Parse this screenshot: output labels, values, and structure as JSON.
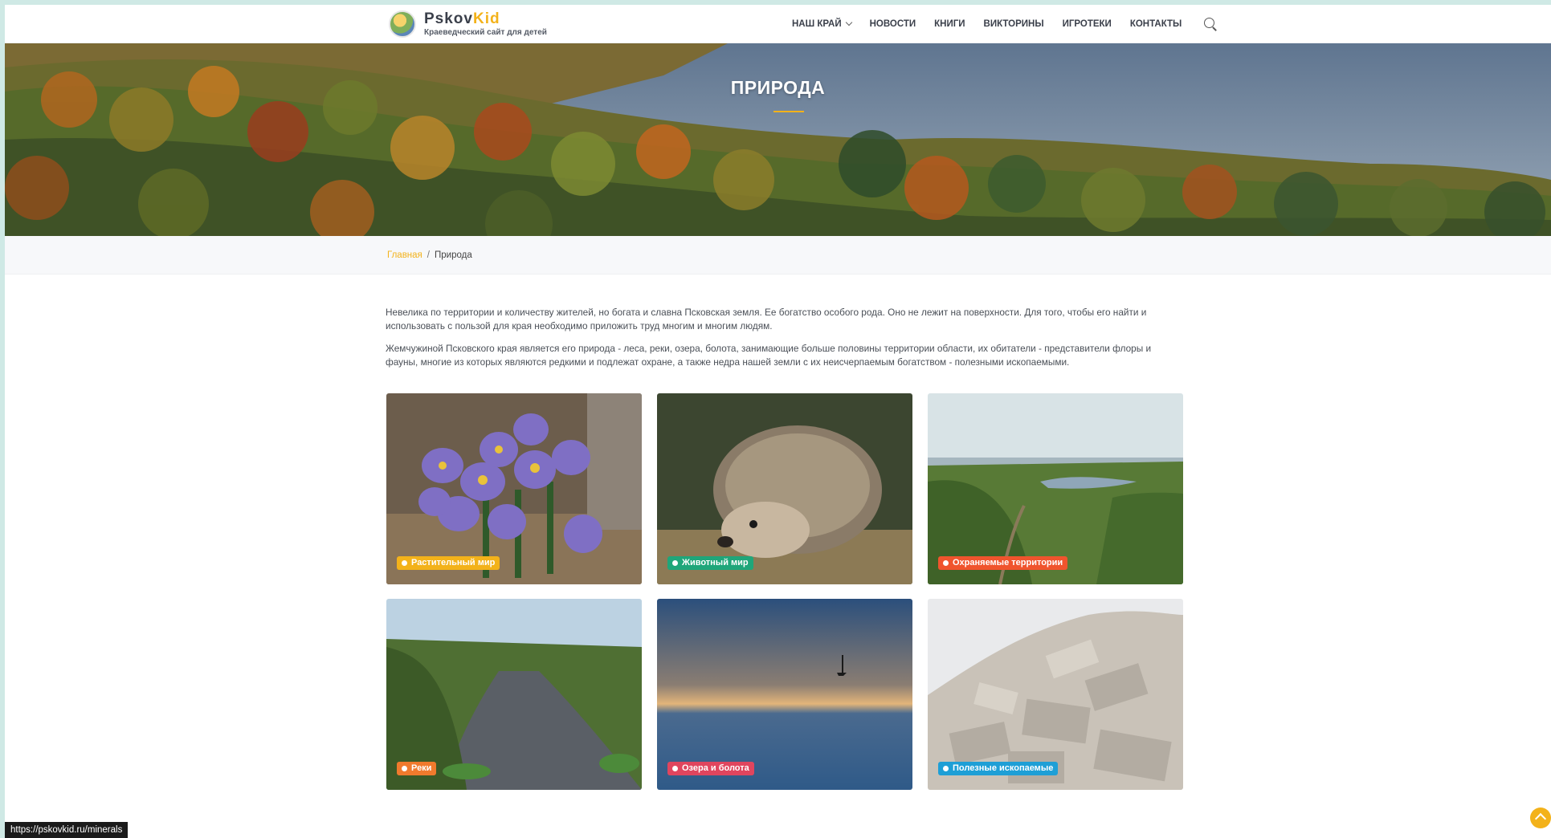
{
  "brand": {
    "name_part1": "Pskov",
    "name_part2": "Kid",
    "tagline": "Краеведческий сайт для детей"
  },
  "nav": {
    "items": [
      {
        "label": "НАШ КРАЙ",
        "has_dropdown": true
      },
      {
        "label": "НОВОСТИ"
      },
      {
        "label": "КНИГИ"
      },
      {
        "label": "ВИКТОРИНЫ"
      },
      {
        "label": "ИГРОТЕКИ"
      },
      {
        "label": "КОНТАКТЫ"
      }
    ],
    "search_icon": "search-icon"
  },
  "hero": {
    "title": "ПРИРОДА"
  },
  "breadcrumb": {
    "home": "Главная",
    "separator": "/",
    "current": "Природа"
  },
  "intro": {
    "p1": "Невелика по территории и количеству жителей, но богата и славна Псковская земля. Ее богатство особого рода. Оно не лежит на поверхности. Для того, чтобы его найти и использовать с пользой для края необходимо приложить труд многим и многим людям.",
    "p2": "Жемчужиной Псковского края является его природа - леса, реки, озера, болота, занимающие больше половины территории области, их обитатели - представители флоры и фауны, многие из которых являются редкими и подлежат охране, а также недра нашей земли с их неисчерпаемым богатством - полезными ископаемыми."
  },
  "cards": [
    {
      "label": "Растительный мир",
      "color": "#f3b21a"
    },
    {
      "label": "Животный мир",
      "color": "#1fa67a"
    },
    {
      "label": "Охраняемые территории",
      "color": "#f0542d"
    },
    {
      "label": "Реки",
      "color": "#f07a2d"
    },
    {
      "label": "Озера и болота",
      "color": "#e0455e"
    },
    {
      "label": "Полезные ископаемые",
      "color": "#1e9fd6"
    }
  ],
  "colors": {
    "accent": "#f3b21a"
  },
  "status_bar": {
    "url": "https://pskovkid.ru/minerals"
  },
  "scroll_top_icon": "arrow-up-icon"
}
